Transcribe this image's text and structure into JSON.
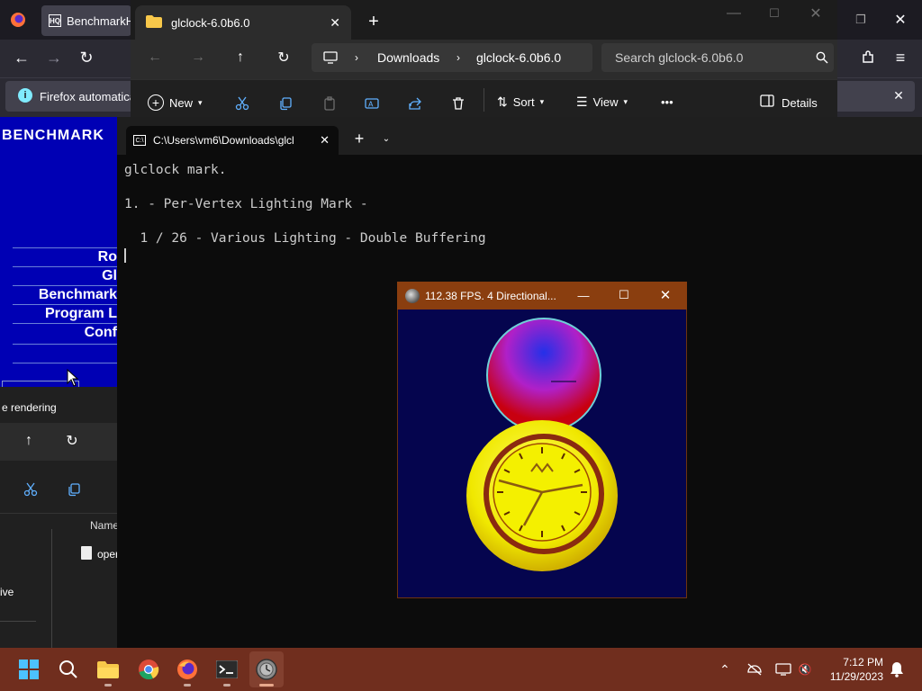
{
  "firefox": {
    "tab_label": "BenchmarkH",
    "tab_icon_text": "HQ",
    "notice_text": "Firefox automaticall",
    "notice_icon": "info-icon"
  },
  "benchmark_page": {
    "logo": "BENCHMARK",
    "links": [
      "Ro",
      "Gl",
      "Benchmark",
      "Program L",
      "Conf"
    ]
  },
  "explorer_bg": {
    "title": "e rendering",
    "column_name": "Name",
    "file_name": "oper",
    "sidebar_item": "ive"
  },
  "file_explorer": {
    "tab_title": "glclock-6.0b6.0",
    "breadcrumb": [
      "Downloads",
      "glclock-6.0b6.0"
    ],
    "search_placeholder": "Search glclock-6.0b6.0",
    "new_label": "New",
    "sort_label": "Sort",
    "view_label": "View",
    "details_label": "Details",
    "more_label": "•••"
  },
  "terminal": {
    "tab_title": "C:\\Users\\vm6\\Downloads\\glcl",
    "lines": [
      "glclock mark.",
      "1. - Per-Vertex Lighting Mark -",
      "  1 / 26 - Various Lighting - Double Buffering"
    ]
  },
  "glclock_window": {
    "title": "112.38 FPS.  4 Directional..."
  },
  "taskbar": {
    "apps": [
      "start-icon",
      "search-icon",
      "file-explorer-icon",
      "chrome-icon",
      "firefox-icon",
      "terminal-icon",
      "glclock-icon"
    ],
    "time": "7:12 PM",
    "date": "11/29/2023"
  },
  "colors": {
    "benchmark_bg": "#0000b4",
    "glclock_titlebar": "#8a3e0f",
    "glclock_bg": "#05054e",
    "taskbar_bg": "#702e1e"
  }
}
